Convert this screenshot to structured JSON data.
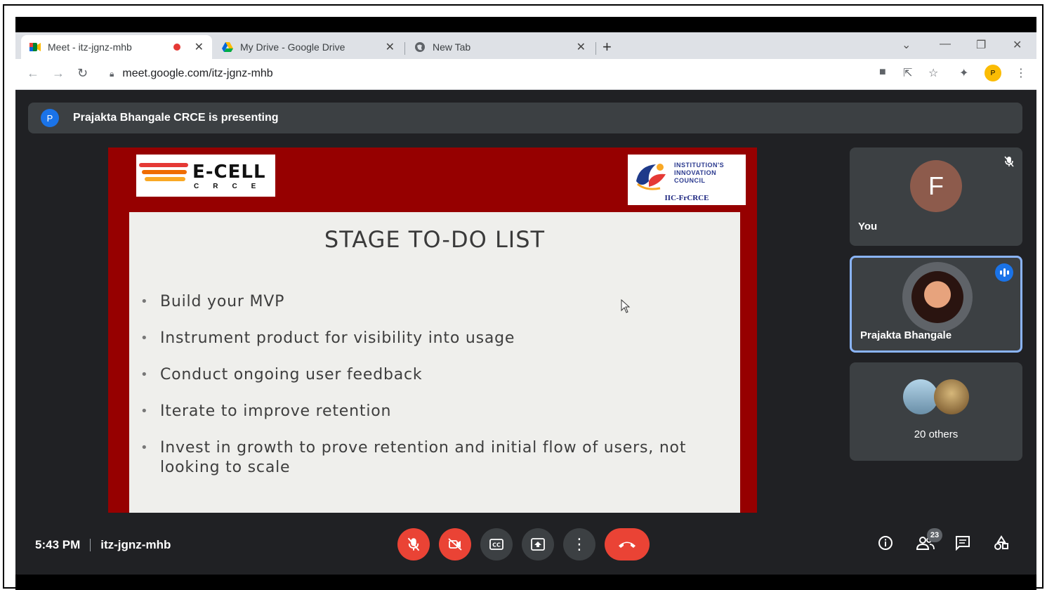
{
  "browser": {
    "tabs": [
      {
        "title": "Meet - itz-jgnz-mhb",
        "icon": "meet-icon",
        "recording": true
      },
      {
        "title": "My Drive - Google Drive",
        "icon": "drive-icon"
      },
      {
        "title": "New Tab",
        "icon": "globe-icon"
      }
    ],
    "url": "meet.google.com/itz-jgnz-mhb",
    "profile_initial": "P"
  },
  "meet": {
    "presenting_avatar": "P",
    "presenting_text": "Prajakta Bhangale CRCE is presenting",
    "slide": {
      "logo_left_word": "E-CELL",
      "logo_left_sub": "CRCE",
      "logo_right_lines": [
        "INSTITUTION'S",
        "INNOVATION",
        "COUNCIL"
      ],
      "logo_right_bottom": "IIC-FrCRCE",
      "title": "STAGE TO-DO LIST",
      "bullets": [
        "Build your MVP",
        "Instrument product for visibility into usage",
        "Conduct ongoing user feedback",
        "Iterate to improve retention",
        "Invest in growth to prove retention and initial flow of users, not looking to scale"
      ]
    },
    "participants": {
      "you": {
        "initial": "F",
        "label": "You",
        "avatar_color": "#8d5b4c"
      },
      "speaker": {
        "label": "Prajakta Bhangale"
      },
      "others": {
        "label": "20 others"
      }
    },
    "bottom": {
      "time": "5:43 PM",
      "meeting_code": "itz-jgnz-mhb",
      "people_count": "23"
    }
  },
  "colors": {
    "meet_bg": "#202124",
    "tile_bg": "#3c4043",
    "danger": "#ea4335",
    "accent": "#1a73e8",
    "slide_red": "#960000"
  }
}
